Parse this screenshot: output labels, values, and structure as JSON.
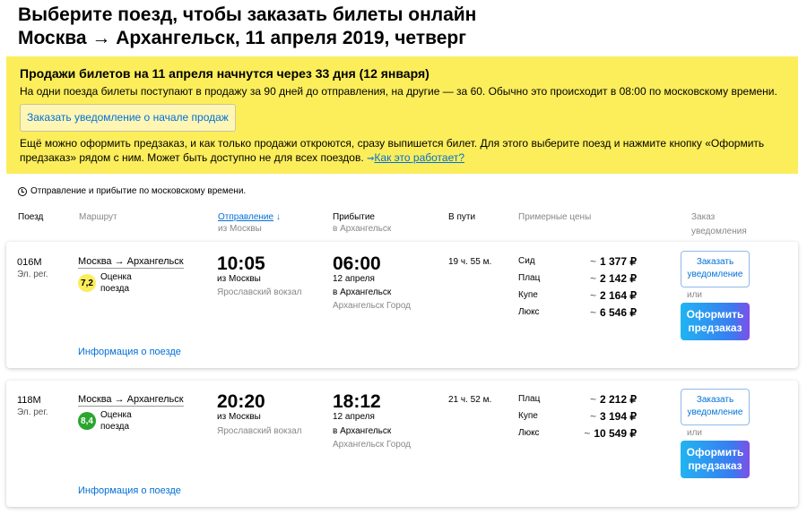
{
  "page": {
    "title_line1": "Выберите поезд, чтобы заказать билеты онлайн",
    "title_line2": "Москва → Архангельск, 11 апреля 2019, четверг"
  },
  "notice": {
    "heading": "Продажи билетов на 11 апреля начнутся через 33 дня (12 января)",
    "text": "На одни поезда билеты поступают в продажу за 90 дней до отправления, на другие — за 60. Обычно это происходит в 08:00 по московскому времени.",
    "notify_button": "Заказать уведомление о начале продаж",
    "preorder_text": "Ещё можно оформить предзаказ, и как только продажи откроются, сразу выпишется билет. Для этого выберите поезд и нажмите кнопку «Оформить предзаказ» рядом с ним. Может быть доступно не для всех поездов.",
    "how_link": "Как это работает?",
    "bg_color": "#fcee5b"
  },
  "tz_note": "Отправление и прибытие по московскому времени.",
  "columns": {
    "train": "Поезд",
    "route": "Маршрут",
    "departure": "Отправление",
    "departure_arrow": "↓",
    "departure_sub": "из Москвы",
    "arrival": "Прибытие",
    "arrival_sub": "в Архангельск",
    "duration": "В пути",
    "prices": "Примерные цены",
    "notify_line1": "Заказ",
    "notify_line2": "уведомления"
  },
  "trains": [
    {
      "number": "016М",
      "type": "Эл. рег.",
      "route": "Москва → Архангельск",
      "rating": "7,2",
      "rating_color": "#fcee5b",
      "rating_text_color": "#000000",
      "rating_label_1": "Оценка",
      "rating_label_2": "поезда",
      "info_link": "Информация о поезде",
      "dep_time": "10:05",
      "dep_from": "из Москвы",
      "dep_station": "Ярославский вокзал",
      "arr_time": "06:00",
      "arr_date": "12 апреля",
      "arr_to": "в Архангельск",
      "arr_station": "Архангельск Город",
      "duration": "19 ч. 55 м.",
      "prices": [
        {
          "class": "Сид",
          "tilde": "~",
          "price": "1 377 ₽"
        },
        {
          "class": "Плац",
          "tilde": "~",
          "price": "2 142 ₽"
        },
        {
          "class": "Купе",
          "tilde": "~",
          "price": "2 164 ₽"
        },
        {
          "class": "Люкс",
          "tilde": "~",
          "price": "6 546 ₽"
        }
      ],
      "notify_btn_1": "Заказать",
      "notify_btn_2": "уведомление",
      "or": "или",
      "preorder_1": "Оформить",
      "preorder_2": "предзаказ"
    },
    {
      "number": "118М",
      "type": "Эл. рег.",
      "route": "Москва → Архангельск",
      "rating": "8,4",
      "rating_color": "#2aa52e",
      "rating_text_color": "#ffffff",
      "rating_label_1": "Оценка",
      "rating_label_2": "поезда",
      "info_link": "Информация о поезде",
      "dep_time": "20:20",
      "dep_from": "из Москвы",
      "dep_station": "Ярославский вокзал",
      "arr_time": "18:12",
      "arr_date": "12 апреля",
      "arr_to": "в Архангельск",
      "arr_station": "Архангельск Город",
      "duration": "21 ч. 52 м.",
      "prices": [
        {
          "class": "Плац",
          "tilde": "~",
          "price": "2 212 ₽"
        },
        {
          "class": "Купе",
          "tilde": "~",
          "price": "3 194 ₽"
        },
        {
          "class": "Люкс",
          "tilde": "~",
          "price": "10 549 ₽"
        }
      ],
      "notify_btn_1": "Заказать",
      "notify_btn_2": "уведомление",
      "or": "или",
      "preorder_1": "Оформить",
      "preorder_2": "предзаказ"
    }
  ],
  "colors": {
    "link": "#0070d8",
    "accent_yellow": "#fcee5b"
  }
}
